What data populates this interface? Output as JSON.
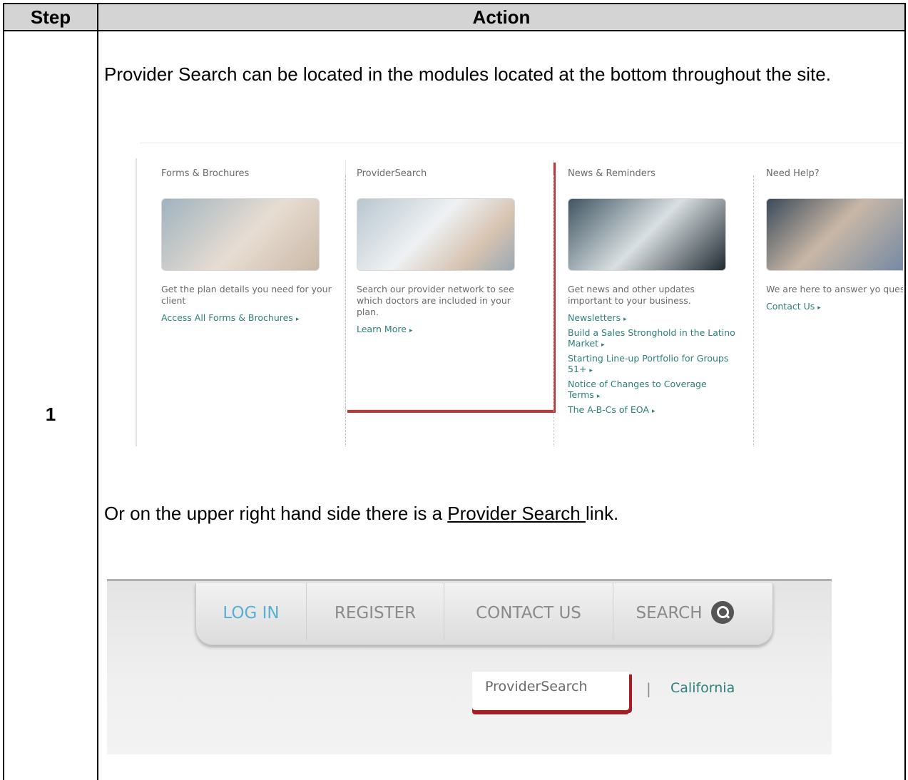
{
  "table": {
    "header_step": "Step",
    "header_action": "Action",
    "step_number": "1"
  },
  "content": {
    "paragraph1": "Provider Search can be located in the modules located at the bottom throughout the site.",
    "paragraph2_prefix": "Or on the upper right hand side there is a ",
    "paragraph2_link": "Provider Search ",
    "paragraph2_suffix": " link."
  },
  "modules": [
    {
      "title": "Forms & Brochures",
      "description": "Get the plan details you need for your client",
      "links": [
        "Access All Forms & Brochures"
      ]
    },
    {
      "title": "ProviderSearch",
      "description": "Search our provider network to see which doctors are included in your plan.",
      "links": [
        "Learn More"
      ]
    },
    {
      "title": "News & Reminders",
      "description": "Get news and other updates important to your business.",
      "links": [
        "Newsletters",
        "Build a Sales Stronghold in the Latino Market",
        "Starting Line-up Portfolio for Groups 51+",
        "Notice of Changes to Coverage Terms",
        "The A-B-Cs of EOA"
      ]
    },
    {
      "title": "Need Help?",
      "description": "We are here to answer yo questions.",
      "links": [
        "Contact Us"
      ]
    }
  ],
  "nav": {
    "login": "LOG IN",
    "register": "REGISTER",
    "contact": "CONTACT US",
    "search": "SEARCH",
    "provider_search": "ProviderSearch",
    "pipe": "|",
    "region": "California"
  },
  "icons": {
    "search": "search-icon",
    "arrow": "chevron-right-icon"
  },
  "colors": {
    "link_teal": "#2d7f7a",
    "login_blue": "#5aaed3",
    "accent_red": "#a41f24",
    "header_gray": "#d4d4d4"
  }
}
